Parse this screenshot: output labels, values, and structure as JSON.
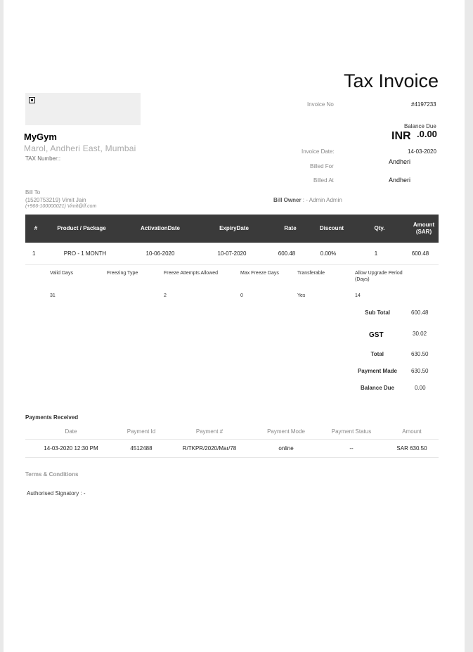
{
  "invoice": {
    "title": "Tax Invoice",
    "invoice_no_label": "Invoice No",
    "invoice_no": "#4197233",
    "balance_due_label": "Balance Due",
    "balance_currency": "INR",
    "balance_amount": ".0.00",
    "invoice_date_label": "Invoice Date:",
    "invoice_date": "14-03-2020",
    "billed_for_label": "Billed For",
    "billed_for": "Andheri",
    "billed_at_label": "Billed At",
    "billed_at": "Andheri"
  },
  "company": {
    "name": "MyGym",
    "address": "Marol, Andheri East, Mumbai",
    "tax_number": "TAX Number::"
  },
  "bill_to": {
    "label": "Bill To",
    "name": "(1520753219) Vimit Jain",
    "contact": "(+966-100000021) Vimit@ff.com",
    "owner_label": "Bill Owner",
    "owner_value": ": - Admin Admin"
  },
  "items_table": {
    "headers": [
      "#",
      "Product / Package",
      "ActivationDate",
      "ExpiryDate",
      "Rate",
      "Discount",
      "Qty.",
      "Amount (SAR)"
    ],
    "rows": [
      [
        "1",
        "PRO - 1 MONTH",
        "10-06-2020",
        "10-07-2020",
        "600.48",
        "0.00%",
        "1",
        "600.48"
      ]
    ]
  },
  "item_details": {
    "headers": [
      "Valid Days",
      "Freezing Type",
      "Freeze Attempts Allowed",
      "Max Freeze Days",
      "Transferable",
      "Allow Upgrade Period (Days)"
    ],
    "values": [
      "31",
      "",
      "2",
      "0",
      "Yes",
      "14"
    ]
  },
  "totals": {
    "sub_total_label": "Sub Total",
    "sub_total": "600.48",
    "gst_label": "GST",
    "gst": "30.02",
    "total_label": "Total",
    "total": "630.50",
    "payment_made_label": "Payment Made",
    "payment_made": "630.50",
    "balance_due_label": "Balance Due",
    "balance_due": "0.00"
  },
  "payments": {
    "title": "Payments Received",
    "headers": [
      "Date",
      "Payment Id",
      "Payment #",
      "Payment Mode",
      "Payment Status",
      "Amount"
    ],
    "rows": [
      [
        "14-03-2020 12:30 PM",
        "4512488",
        "R/TKPR/2020/Mar/78",
        "online",
        "--",
        "SAR 630.50"
      ]
    ]
  },
  "footer": {
    "terms": "Terms & Conditions",
    "signatory": "Authorised Signatory : -"
  },
  "icons": {
    "logo": "logo-placeholder-icon"
  }
}
